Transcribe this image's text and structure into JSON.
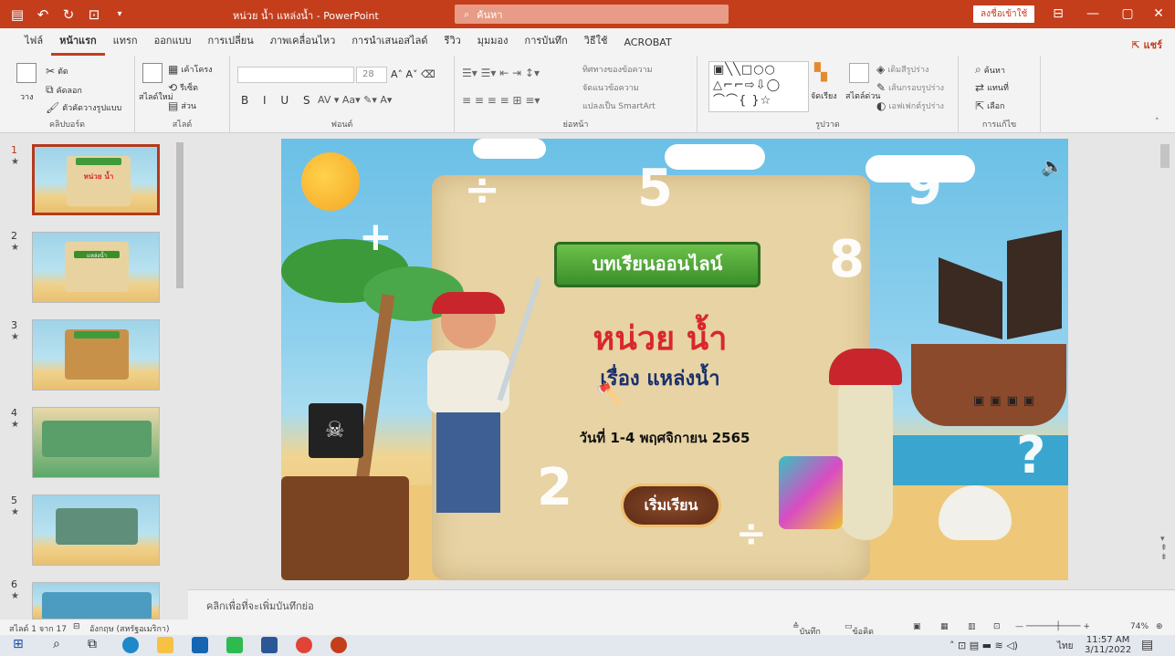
{
  "window": {
    "title": "หน่วย น้ำ แหล่งน้ำ - PowerPoint",
    "search_label": "ค้นหา",
    "signin_label": "ลงชื่อเข้าใช้"
  },
  "ribbon": {
    "tabs": [
      "ไฟล์",
      "หน้าแรก",
      "แทรก",
      "ออกแบบ",
      "การเปลี่ยน",
      "ภาพเคลื่อนไหว",
      "การนำเสนอสไลด์",
      "รีวิว",
      "มุมมอง",
      "การบันทึก",
      "วิธีใช้",
      "ACROBAT"
    ],
    "active_tab": "หน้าแรก",
    "share_label": "แชร์",
    "groups": {
      "clipboard": {
        "label": "คลิปบอร์ด",
        "paste": "วาง",
        "cut": "ตัด",
        "copy": "คัดลอก",
        "format_painter": "ตัวคัดวางรูปแบบ"
      },
      "slides": {
        "label": "สไลด์",
        "new_slide": "สไลด์ใหม่",
        "layout": "เค้าโครง",
        "reset": "รีเซ็ต",
        "section": "ส่วน"
      },
      "font": {
        "label": "ฟอนต์",
        "size": "28"
      },
      "paragraph": {
        "label": "ย่อหน้า",
        "text_direction": "ทิศทางของข้อความ",
        "align_text": "จัดแนวข้อความ",
        "convert_smartart": "แปลงเป็น SmartArt"
      },
      "drawing": {
        "label": "รูปวาด",
        "arrange": "จัดเรียง",
        "quick_styles": "สไตล์ด่วน",
        "shape_fill": "เติมสีรูปร่าง",
        "shape_outline": "เส้นกรอบรูปร่าง",
        "shape_effects": "เอฟเฟกต์รูปร่าง"
      },
      "editing": {
        "label": "การแก้ไข",
        "find": "ค้นหา",
        "replace": "แทนที่",
        "select": "เลือก"
      }
    }
  },
  "thumbnails": [
    {
      "num": "1",
      "selected": true,
      "banner": "หน่วย น้ำ"
    },
    {
      "num": "2",
      "selected": false,
      "banner": "แหล่งน้ำ"
    },
    {
      "num": "3",
      "selected": false,
      "banner": ""
    },
    {
      "num": "4",
      "selected": false,
      "banner": ""
    },
    {
      "num": "5",
      "selected": false,
      "banner": ""
    },
    {
      "num": "6",
      "selected": false,
      "banner": ""
    }
  ],
  "slide": {
    "banner": "บทเรียนออนไลน์",
    "title": "หน่วย น้ำ",
    "subtitle": "เรื่อง แหล่งน้ำ",
    "date": "วันที่ 1-4 พฤศจิกายน 2565",
    "start_button": "เริ่มเรียน",
    "numbers": [
      "5",
      "9",
      "8",
      "2",
      "?"
    ]
  },
  "notes_placeholder": "คลิกเพื่อที่จะเพิ่มบันทึกย่อ",
  "statusbar": {
    "slide_info": "สไลด์ 1 จาก 17",
    "language": "อังกฤษ (สหรัฐอเมริกา)",
    "notes": "บันทึกย่อ",
    "comments": "ข้อคิดเห็น",
    "zoom": "74%"
  },
  "taskbar": {
    "time": "11:57 AM",
    "date": "3/11/2022",
    "lang": "ไทย"
  },
  "colors": {
    "accent": "#c43e1c",
    "banner_green": "#3a8f2a",
    "title_red": "#d9272e",
    "subtitle_navy": "#1a2f6e"
  }
}
